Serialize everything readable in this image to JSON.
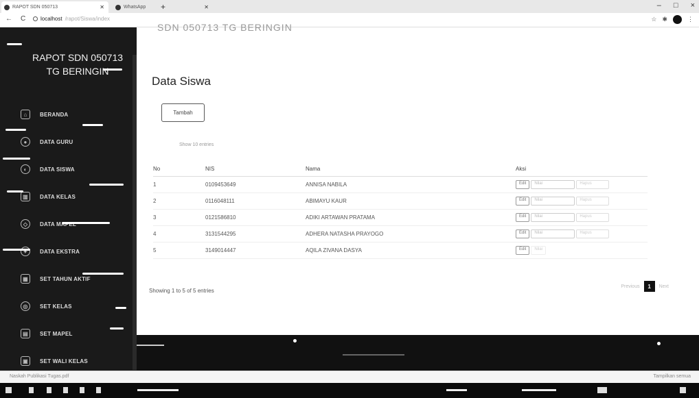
{
  "browser": {
    "tabs": [
      {
        "label": "RAPOT SDN 050713",
        "active": true
      },
      {
        "label": "WhatsApp",
        "active": false
      }
    ],
    "url_host": "localhost",
    "url_path": "/rapot/Siswa/index",
    "window_controls": [
      "–",
      "□",
      "×"
    ]
  },
  "sidebar": {
    "brand": "RAPOT SDN 050713 TG BERINGIN",
    "items": [
      {
        "label": "BERANDA",
        "icon": "home-icon"
      },
      {
        "label": "DATA GURU",
        "icon": "user-icon"
      },
      {
        "label": "DATA SISWA",
        "icon": "users-icon"
      },
      {
        "label": "DATA KELAS",
        "icon": "building-icon"
      },
      {
        "label": "DATA MAPEL",
        "icon": "book-icon"
      },
      {
        "label": "DATA EKSTRA",
        "icon": "star-icon"
      },
      {
        "label": "SET TAHUN AKTIF",
        "icon": "calendar-icon"
      },
      {
        "label": "SET KELAS",
        "icon": "class-icon"
      },
      {
        "label": "SET MAPEL",
        "icon": "mapel-icon"
      },
      {
        "label": "SET WALI KELAS",
        "icon": "wali-icon"
      }
    ]
  },
  "main": {
    "cut_title": "SDN 050713 TG BERINGIN",
    "page_title": "Data Siswa",
    "add_button": "Tambah",
    "length_label": "Show 10 entries",
    "columns": [
      "No",
      "NIS",
      "Nama",
      "Aksi"
    ],
    "rows": [
      {
        "no": "1",
        "nis": "0109453649",
        "nama": "ANNISA NABILA"
      },
      {
        "no": "2",
        "nis": "0116048111",
        "nama": "ABIMAYU KAUR"
      },
      {
        "no": "3",
        "nis": "0121586810",
        "nama": "ADIKI ARTAWAN PRATAMA"
      },
      {
        "no": "4",
        "nis": "3131544295",
        "nama": "ADHERA NATASHA PRAYOGO"
      },
      {
        "no": "5",
        "nis": "3149014447",
        "nama": "AQILA ZIVANA DASYA"
      }
    ],
    "action_labels": {
      "edit": "Edit",
      "nilai": "Nilai",
      "hapus": "Hapus"
    },
    "info": "Showing 1 to 5 of 5 entries",
    "pager": {
      "prev": "Previous",
      "current": "1",
      "next": "Next"
    }
  },
  "downloads": {
    "file": "Naskah Publikasi Tugas.pdf",
    "show_all": "Tampilkan semua"
  }
}
